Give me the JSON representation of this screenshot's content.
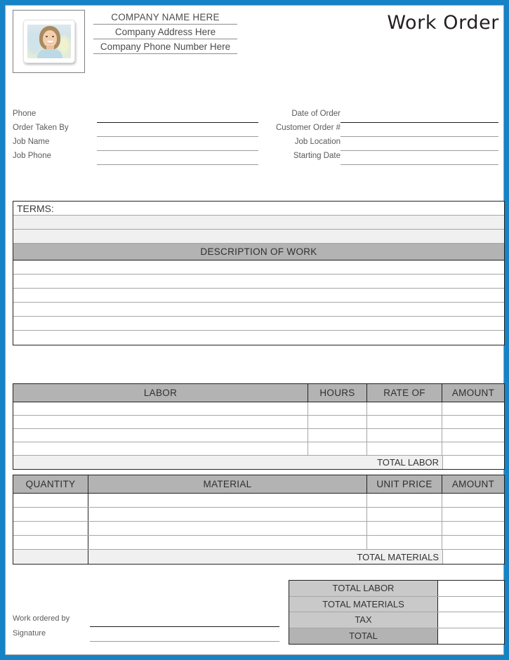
{
  "document": {
    "title": "Work Order"
  },
  "header": {
    "logo_placeholder": "photo-placeholder",
    "company_name": "COMPANY NAME HERE",
    "company_address": "Company Address Here",
    "company_phone": "Company Phone Number Here"
  },
  "fields": {
    "left": [
      {
        "label": "Phone",
        "value": ""
      },
      {
        "label": "Order Taken By",
        "value": ""
      },
      {
        "label": "Job Name",
        "value": ""
      },
      {
        "label": "Job Phone",
        "value": ""
      }
    ],
    "right": [
      {
        "label": "Date of Order",
        "value": ""
      },
      {
        "label": "Customer Order #",
        "value": ""
      },
      {
        "label": "Job Location",
        "value": ""
      },
      {
        "label": "Starting Date",
        "value": ""
      }
    ]
  },
  "terms": {
    "title": "TERMS:",
    "lines": [
      "",
      ""
    ]
  },
  "description": {
    "header": "DESCRIPTION OF WORK",
    "rows": [
      "",
      "",
      "",
      "",
      "",
      ""
    ]
  },
  "labor": {
    "headers": [
      "LABOR",
      "HOURS",
      "RATE OF",
      "AMOUNT"
    ],
    "rows": [
      {
        "labor": "",
        "hours": "",
        "rate": "",
        "amount": ""
      },
      {
        "labor": "",
        "hours": "",
        "rate": "",
        "amount": ""
      },
      {
        "labor": "",
        "hours": "",
        "rate": "",
        "amount": ""
      },
      {
        "labor": "",
        "hours": "",
        "rate": "",
        "amount": ""
      }
    ],
    "total_label": "TOTAL LABOR",
    "total_value": ""
  },
  "material": {
    "headers": [
      "QUANTITY",
      "MATERIAL",
      "UNIT PRICE",
      "AMOUNT"
    ],
    "rows": [
      {
        "quantity": "",
        "material": "",
        "unit_price": "",
        "amount": ""
      },
      {
        "quantity": "",
        "material": "",
        "unit_price": "",
        "amount": ""
      },
      {
        "quantity": "",
        "material": "",
        "unit_price": "",
        "amount": ""
      },
      {
        "quantity": "",
        "material": "",
        "unit_price": "",
        "amount": ""
      }
    ],
    "total_label": "TOTAL MATERIALS",
    "total_value": ""
  },
  "totals": [
    {
      "label": "TOTAL LABOR",
      "value": ""
    },
    {
      "label": "TOTAL MATERIALS",
      "value": ""
    },
    {
      "label": "TAX",
      "value": ""
    },
    {
      "label": "TOTAL",
      "value": ""
    }
  ],
  "signatures": [
    {
      "label": "Work ordered by",
      "value": ""
    },
    {
      "label": "Signature",
      "value": ""
    }
  ],
  "colors": {
    "page_border": "#1484c6",
    "header_fill": "#b3b3b3",
    "shade_light": "#f0f0f0",
    "shade_mid": "#c9c9c9",
    "rule": "#a6a6a6",
    "text": "#333333"
  }
}
